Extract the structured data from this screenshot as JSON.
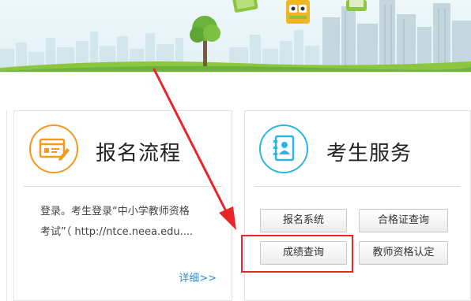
{
  "left_card": {
    "icon": "registration-form-icon",
    "title": "报名流程",
    "body_line1": "登录。考生登录“中小学教师资格",
    "body_line2": "考试”（ http://ntce.neea.edu....",
    "more": "详细>>"
  },
  "right_card": {
    "icon": "contact-book-icon",
    "title": "考生服务",
    "buttons": {
      "registration_system": "报名系统",
      "certificate_query": "合格证查询",
      "score_query": "成绩查询",
      "teacher_cert": "教师资格认定"
    }
  },
  "annotation": {
    "color": "#e8262a",
    "target": "成绩查询"
  },
  "colors": {
    "orange_accent": "#f39a1c",
    "blue_accent": "#29b6e5",
    "link": "#2a8fd0"
  }
}
